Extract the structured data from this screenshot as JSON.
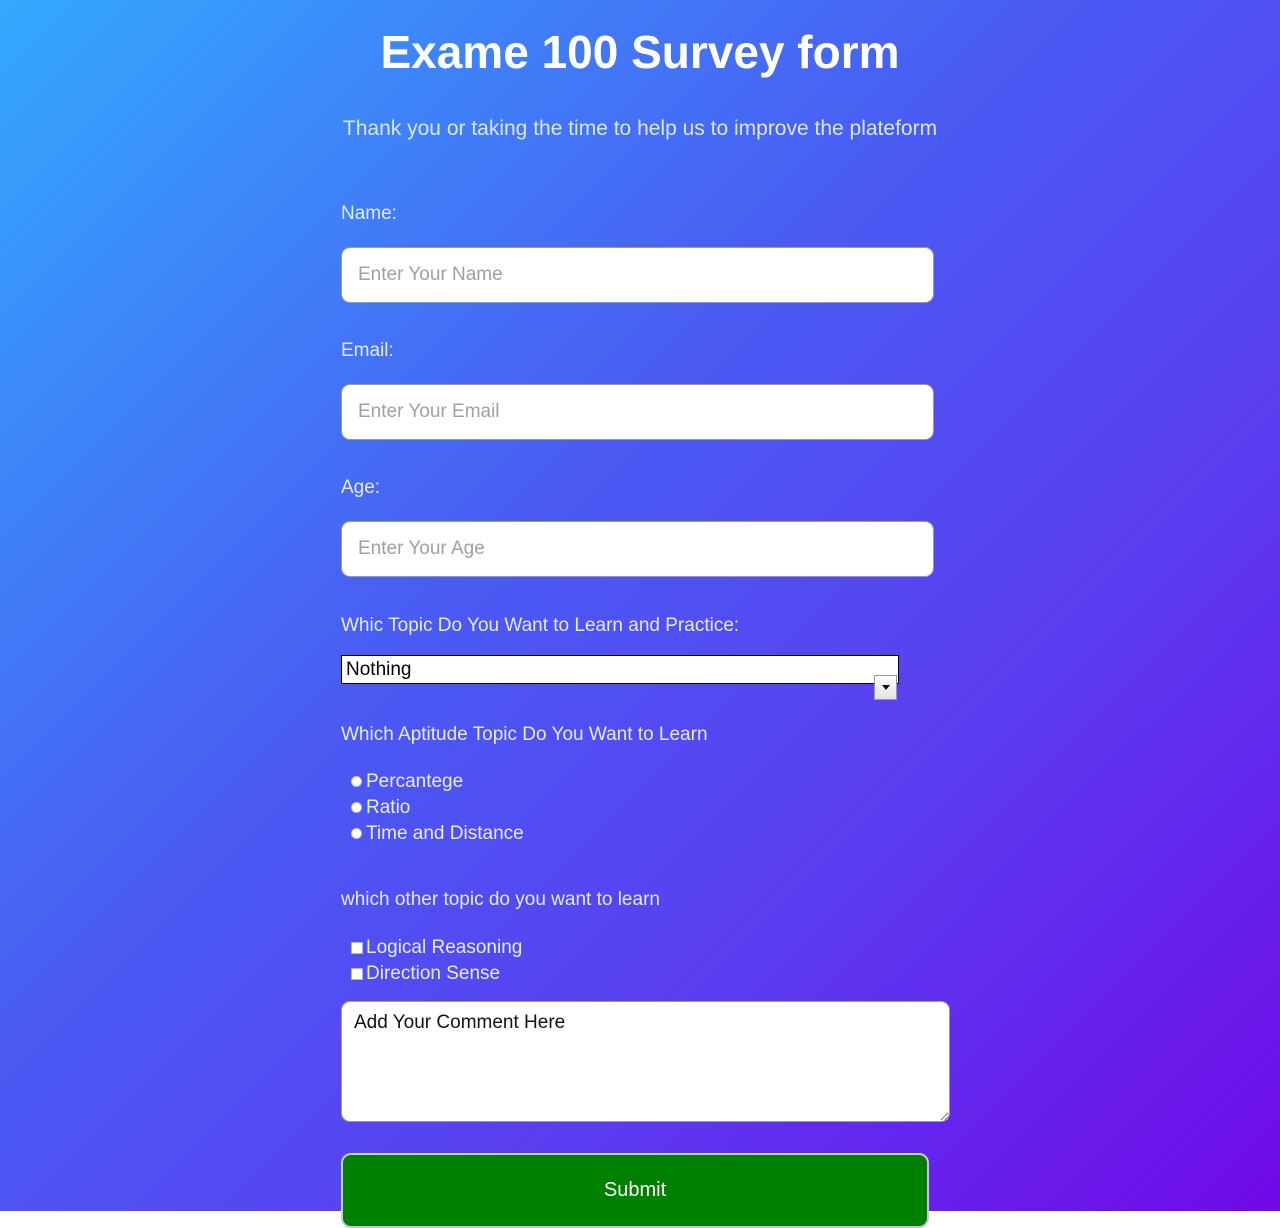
{
  "header": {
    "title": "Exame 100 Survey form",
    "subtitle": "Thank you or taking the time to help us to improve the plateform"
  },
  "form": {
    "name": {
      "label": "Name:",
      "placeholder": "Enter Your Name",
      "value": ""
    },
    "email": {
      "label": "Email:",
      "placeholder": "Enter Your Email",
      "value": ""
    },
    "age": {
      "label": "Age:",
      "placeholder": "Enter Your Age",
      "value": ""
    },
    "topic_select": {
      "label": "Whic Topic Do You Want to Learn and Practice:",
      "selected": "Nothing",
      "options": [
        "Nothing"
      ]
    },
    "aptitude": {
      "label": "Which Aptitude Topic Do You Want to Learn",
      "options": [
        {
          "label": "Percantege",
          "checked": false
        },
        {
          "label": "Ratio",
          "checked": false
        },
        {
          "label": "Time and Distance",
          "checked": false
        }
      ]
    },
    "other_topics": {
      "label": "which other topic do you want to learn",
      "options": [
        {
          "label": "Logical Reasoning",
          "checked": false
        },
        {
          "label": "Direction Sense",
          "checked": false
        }
      ]
    },
    "comment": {
      "value": "Add Your Comment Here",
      "placeholder": "Add Your Comment Here"
    },
    "submit": {
      "label": "Submit"
    }
  },
  "colors": {
    "gradient_start": "#33a9fd",
    "gradient_mid": "#4a5bf3",
    "gradient_end": "#7009e8",
    "title_text": "#ffffff",
    "label_text": "#e3ecff",
    "submit_bg": "#008000",
    "input_bg": "#ffffff"
  }
}
